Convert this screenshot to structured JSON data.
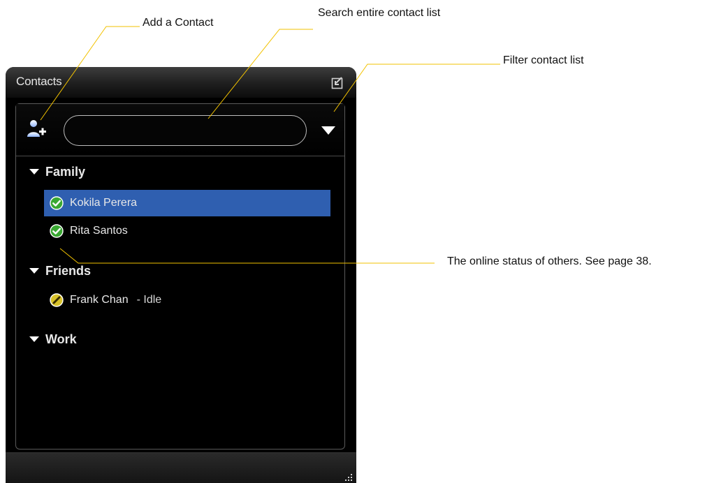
{
  "callouts": {
    "add_contact": "Add a Contact",
    "search": "Search entire contact list",
    "filter": "Filter contact list",
    "status": "The online status of others. See page 38."
  },
  "panel": {
    "title": "Contacts",
    "search": {
      "value": "",
      "placeholder": ""
    },
    "groups": [
      {
        "name": "Family",
        "contacts": [
          {
            "name": "Kokila Perera",
            "status": "online",
            "selected": true,
            "note": ""
          },
          {
            "name": "Rita Santos",
            "status": "online",
            "selected": false,
            "note": ""
          }
        ]
      },
      {
        "name": "Friends",
        "contacts": [
          {
            "name": "Frank Chan",
            "status": "idle",
            "selected": false,
            "note": "- Idle"
          }
        ]
      },
      {
        "name": "Work",
        "contacts": []
      }
    ]
  },
  "colors": {
    "leader_line": "#f2c200",
    "selection": "#2f5fb0",
    "online": "#3aa832",
    "idle": "#d8c22a"
  },
  "icons": {
    "add_contact": "person-plus-icon",
    "filter": "triangle-down-icon",
    "popout": "popout-icon",
    "group_expand": "triangle-down-icon",
    "online": "check-circle-icon",
    "idle": "pencil-circle-icon",
    "resize": "resize-grip-icon"
  }
}
